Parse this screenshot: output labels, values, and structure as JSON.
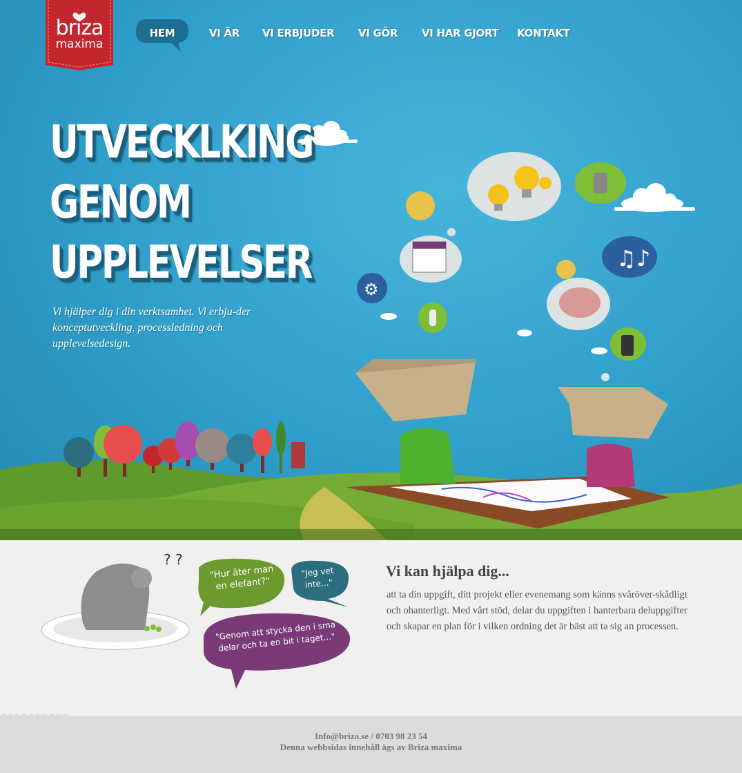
{
  "logo": {
    "line1": "briza",
    "line2": "maxima"
  },
  "nav": [
    {
      "label": "HEM",
      "active": true
    },
    {
      "label": "VI ÄR",
      "active": false
    },
    {
      "label": "VI ERBJUDER",
      "active": false
    },
    {
      "label": "VI GÖR",
      "active": false
    },
    {
      "label": "VI HAR GJORT",
      "active": false
    },
    {
      "label": "KONTAKT",
      "active": false
    }
  ],
  "hero": {
    "headline": [
      "UTVECKLKING",
      "GENOM",
      "UPPLEVELSER"
    ],
    "intro": "Vi hjälper dig i din verktsamhet. Vi erbju-der konceptutveckling, processledning och upplevelsedesign."
  },
  "illustration": {
    "box_labels": [
      "briza maxima",
      "briza maxima"
    ],
    "bubble_1": "\"Hur äter man en elefant?\"",
    "bubble_2": "\"Jeg vet inte...\"",
    "bubble_3": "\"Genom att stycka den i sma delar och ta en bit i taget...\"",
    "question_marks": "? ?"
  },
  "help": {
    "title": "Vi kan hjälpa dig...",
    "text": "att ta din uppgift, ditt projekt eller evenemang som känns svåröver-skådligt och ohanterligt. Med vårt stöd, delar du uppgiften i hanterbara deluppgifter och skapar en plan för i vilken ordning det är bäst att ta sig an processen."
  },
  "footer": {
    "contact": "Info@briza.se / 0703 98 23 54",
    "owner": "Denna webbsidas innehåll ägs av Briza maxima"
  },
  "colors": {
    "sky": "#2f9ec9",
    "logo_red": "#c4262e",
    "nav_bubble": "#1d6e93",
    "grass": "#6aa22f",
    "bubble_green": "#6c9a2e",
    "bubble_teal": "#2c6d80",
    "bubble_purple": "#7a3a78"
  }
}
